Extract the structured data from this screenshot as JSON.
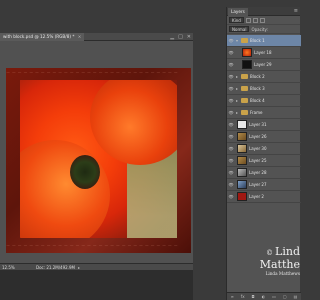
{
  "document": {
    "tab_title": "with block.psd @ 12.5% (RGB/8) *",
    "close_glyph": "×"
  },
  "status_bar": {
    "zoom": "12.5%",
    "doc_size": "Doc: 21.2M/492.9M",
    "arrow_glyph": "▸"
  },
  "layers_panel": {
    "tab_label": "Layers",
    "kind_filter": "Kind",
    "blend_mode": "Normal",
    "opacity_label": "Opacity:",
    "layers": [
      {
        "name": "Block 1",
        "type": "group",
        "open": true,
        "selected": true
      },
      {
        "name": "Layer 18",
        "type": "layer",
        "indent": 1,
        "thumb": "flower"
      },
      {
        "name": "Layer 29",
        "type": "layer",
        "indent": 1,
        "thumb": "black"
      },
      {
        "name": "Block 2",
        "type": "group"
      },
      {
        "name": "Block 3",
        "type": "group"
      },
      {
        "name": "Block 4",
        "type": "group"
      },
      {
        "name": "Frame",
        "type": "group"
      },
      {
        "name": "Layer 31",
        "type": "layer",
        "thumb": "light"
      },
      {
        "name": "Layer 26",
        "type": "layer",
        "thumb": "tan"
      },
      {
        "name": "Layer 30",
        "type": "layer",
        "thumb": "tan2"
      },
      {
        "name": "Layer 25",
        "type": "layer",
        "thumb": "tan"
      },
      {
        "name": "Layer 28",
        "type": "layer",
        "thumb": "grey"
      },
      {
        "name": "Layer 27",
        "type": "layer",
        "thumb": "blue"
      },
      {
        "name": "Layer 2",
        "type": "layer",
        "thumb": "red"
      }
    ]
  },
  "watermark": {
    "copyright": "©",
    "line1": "Lind",
    "line2": "Matthe",
    "line3": "Linda Matthews"
  },
  "colors": {
    "selection": "#6d86a7",
    "panel_bg": "#535353",
    "folder": "#c9a24a"
  }
}
